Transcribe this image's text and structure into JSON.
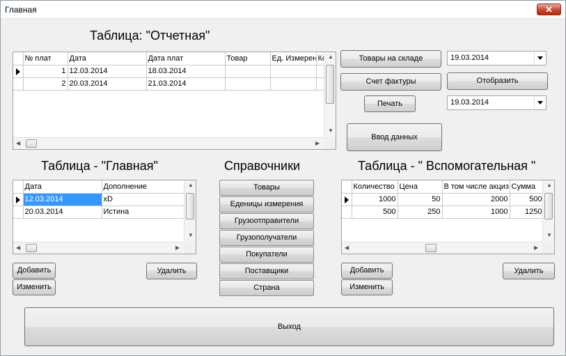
{
  "window": {
    "title": "Главная",
    "close_label": "✕"
  },
  "headings": {
    "report": "Таблица: \"Отчетная\"",
    "main": "Таблица - \"Главная\"",
    "refs": "Справочники",
    "aux": "Таблица - \" Вспомогательная \""
  },
  "report_table": {
    "columns": [
      "№ плат",
      "Дата",
      "Дата плат",
      "Товар",
      "Ед. Измерен",
      "Ко"
    ],
    "rows": [
      [
        "1",
        "12.03.2014",
        "18.03.2014",
        "",
        "",
        ""
      ],
      [
        "2",
        "20.03.2014",
        "21.03.2014",
        "",
        "",
        ""
      ]
    ]
  },
  "main_table": {
    "columns": [
      "Дата",
      "Дополнение"
    ],
    "rows": [
      [
        "12.03.2014",
        "xD"
      ],
      [
        "20.03.2014",
        "Истина"
      ]
    ]
  },
  "aux_table": {
    "columns": [
      "Количество",
      "Цена",
      "В том числе акциз",
      "Сумма"
    ],
    "rows": [
      [
        "1000",
        "50",
        "2000",
        "500"
      ],
      [
        "500",
        "250",
        "1000",
        "1250"
      ]
    ]
  },
  "buttons": {
    "stock": "Товары на складе",
    "invoice": "Счет фактуры",
    "print": "Печать",
    "show": "Отобразить",
    "data_entry": "Ввод данных",
    "main_add": "Добавить",
    "main_edit": "Изменить",
    "main_delete": "Удалить",
    "aux_add": "Добавить",
    "aux_edit": "Изменить",
    "aux_delete": "Удалить",
    "exit": "Выход"
  },
  "combos": {
    "date1": "19.03.2014",
    "date2": "19.03.2014"
  },
  "references": [
    "Товары",
    "Еденицы измерения",
    "Грузоотправители",
    "Грузополучатели",
    "Покупатели",
    "Поставщики",
    "Страна"
  ],
  "icons": {
    "row_selector": "triangle-right-icon",
    "dropdown": "chevron-down-icon"
  }
}
